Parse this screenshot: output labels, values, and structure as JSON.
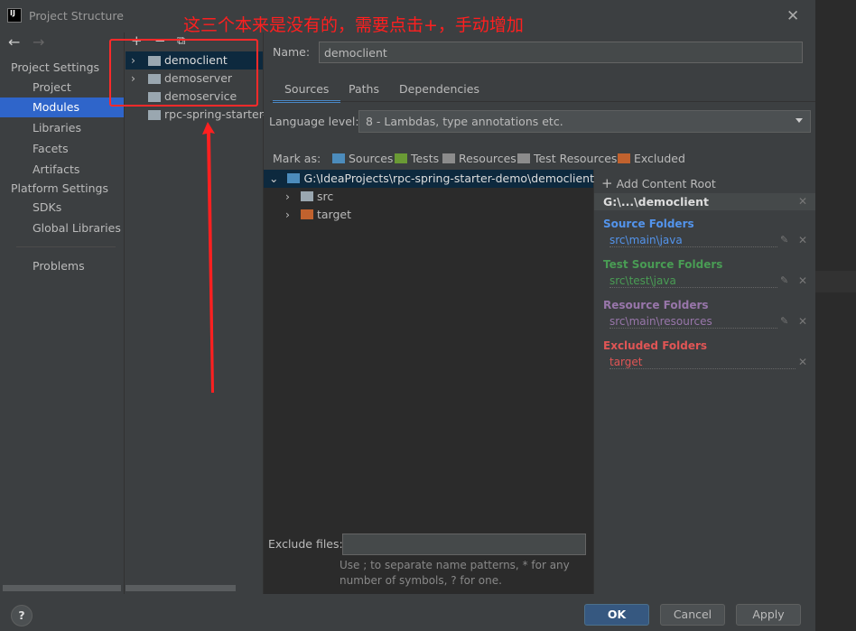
{
  "window": {
    "title": "Project Structure",
    "app_icon": "IJ"
  },
  "annotation": {
    "text": "这三个本来是没有的，需要点击+，手动增加",
    "color": "#ff1f1f"
  },
  "nav": {
    "back": "←",
    "forward": "→",
    "project_settings_header": "Project Settings",
    "project_items": [
      "Project",
      "Modules",
      "Libraries",
      "Facets",
      "Artifacts"
    ],
    "platform_settings_header": "Platform Settings",
    "platform_items": [
      "SDKs",
      "Global Libraries"
    ],
    "problems": "Problems",
    "selected": "Modules"
  },
  "module_toolbar": {
    "add": "+",
    "remove": "−",
    "copy": "⧉"
  },
  "modules": [
    {
      "name": "democlient",
      "expandable": true,
      "selected": true
    },
    {
      "name": "demoserver",
      "expandable": true
    },
    {
      "name": "demoservice",
      "expandable": false
    },
    {
      "name": "rpc-spring-starter-",
      "expandable": false
    }
  ],
  "main": {
    "name_label": "Name:",
    "name_value": "democlient",
    "tabs": [
      "Sources",
      "Paths",
      "Dependencies"
    ],
    "active_tab": "Sources",
    "language_level_label": "Language level:",
    "language_level_value": "8 - Lambdas, type annotations etc.",
    "mark_as_label": "Mark as:",
    "mark_as": [
      "Sources",
      "Tests",
      "Resources",
      "Test Resources",
      "Excluded"
    ],
    "tree": {
      "root": "G:\\IdeaProjects\\rpc-spring-starter-demo\\democlient",
      "children": [
        "src",
        "target"
      ]
    },
    "exclude_files_label": "Exclude files:",
    "exclude_files_value": "",
    "exclude_hint_line1": "Use ; to separate name patterns, * for any",
    "exclude_hint_line2": "number of symbols, ? for one."
  },
  "content_root": {
    "add_label": "Add Content Root",
    "root_path": "G:\\...\\democlient",
    "sections": [
      {
        "title": "Source Folders",
        "path": "src\\main\\java",
        "color": "#5394ec",
        "editable": true
      },
      {
        "title": "Test Source Folders",
        "path": "src\\test\\java",
        "color": "#499c54",
        "editable": true
      },
      {
        "title": "Resource Folders",
        "path": "src\\main\\resources",
        "color": "#9876aa",
        "editable": true
      },
      {
        "title": "Excluded Folders",
        "path": "target",
        "color": "#e05555",
        "editable": false
      }
    ]
  },
  "buttons": {
    "help": "?",
    "ok": "OK",
    "cancel": "Cancel",
    "apply": "Apply"
  }
}
